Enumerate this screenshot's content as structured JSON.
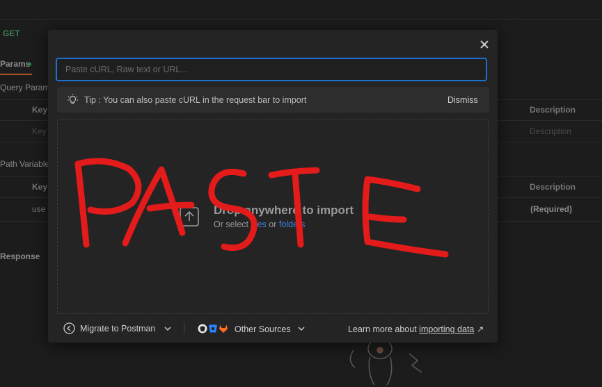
{
  "background": {
    "method": "GET",
    "params_tab": "Params",
    "query_params_label": "Query Params",
    "path_variables_label": "Path Variables",
    "response_label": "Response",
    "col_key": "Key",
    "col_description": "Description",
    "key_placeholder": "Key",
    "description_placeholder": "Description",
    "path_key_value": "use",
    "required_label": "(Required)"
  },
  "modal": {
    "input_placeholder": "Paste cURL, Raw text or URL...",
    "tip_text": "Tip : You can also paste cURL in the request bar to import",
    "dismiss_label": "Dismiss",
    "drop_title": "Drop anywhere to import",
    "drop_sub_prefix": "Or select",
    "drop_files_link": "files",
    "drop_or": "or",
    "drop_folders_link": "folders",
    "migrate_label": "Migrate to Postman",
    "other_sources_label": "Other Sources",
    "learn_more_prefix": "Learn more about",
    "learn_more_link": "importing data",
    "learn_more_arrow": "↗"
  },
  "annotation": {
    "text": "PASTE",
    "color": "#e31b1b"
  },
  "icons": {
    "close": "close-icon",
    "tip": "lightbulb-icon",
    "upload": "upload-icon",
    "migrate": "migrate-icon",
    "github": "github-icon",
    "bitbucket": "bitbucket-icon",
    "gitlab": "gitlab-icon",
    "chevron": "chevron-down-icon"
  },
  "colors": {
    "accent_blue": "#1f6fd1",
    "link_blue": "#3d84e0",
    "method_green": "#3f7f55"
  }
}
